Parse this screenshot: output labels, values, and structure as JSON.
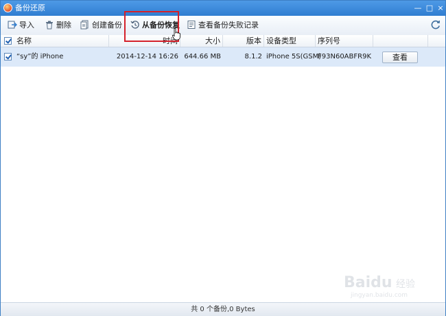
{
  "window": {
    "title": "备份还原",
    "controls": {
      "minimize": "—",
      "maximize": "□",
      "close": "×"
    }
  },
  "toolbar": {
    "import_label": "导入",
    "delete_label": "删除",
    "create_backup_label": "创建备份",
    "restore_label": "从备份恢复",
    "fail_log_label": "查看备份失败记录",
    "refresh_icon": "refresh-icon"
  },
  "table": {
    "columns": [
      "名称",
      "时间",
      "大小",
      "版本",
      "设备类型",
      "序列号"
    ],
    "rows": [
      {
        "checked": true,
        "name": "“sy”的 iPhone",
        "time": "2014-12-14 16:26",
        "size": "644.66 MB",
        "version": "8.1.2",
        "device_type": "iPhone 5S(GSM)",
        "serial": "F93N60ABFR9K",
        "action_label": "查看"
      }
    ]
  },
  "status": {
    "text": "共 0 个备份,0 Bytes"
  },
  "watermark": {
    "brand": "Baidu",
    "sub": "经验",
    "url": "jingyan.baidu.com"
  },
  "colors": {
    "titlebar": "#2f7dd1",
    "row_selected": "#dce9f9",
    "highlight_box": "#d4202a"
  }
}
